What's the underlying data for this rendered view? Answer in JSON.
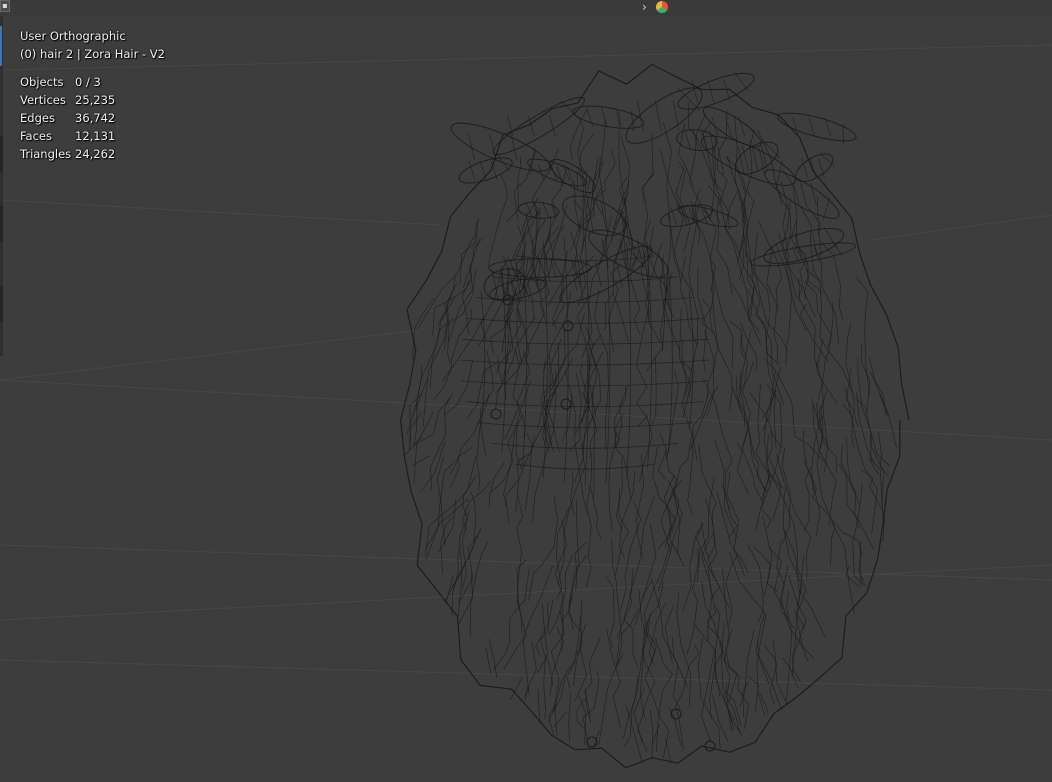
{
  "viewport": {
    "view_name": "User Orthographic",
    "object_name": "(0) hair 2 | Zora Hair - V2",
    "stats": [
      {
        "label": "Objects",
        "value": "0 / 3"
      },
      {
        "label": "Vertices",
        "value": "25,235"
      },
      {
        "label": "Edges",
        "value": "36,742"
      },
      {
        "label": "Faces",
        "value": "12,131"
      },
      {
        "label": "Triangles",
        "value": "24,262"
      }
    ]
  },
  "header": {
    "chevron_glyph": "›"
  },
  "colors": {
    "background": "#3d3d3d",
    "wire": "#1a1a1a",
    "accent": "#4772b3",
    "grid": "#474747"
  },
  "icons": [
    "chevron-right-icon",
    "render-engine-icon",
    "editor-type-icon"
  ]
}
